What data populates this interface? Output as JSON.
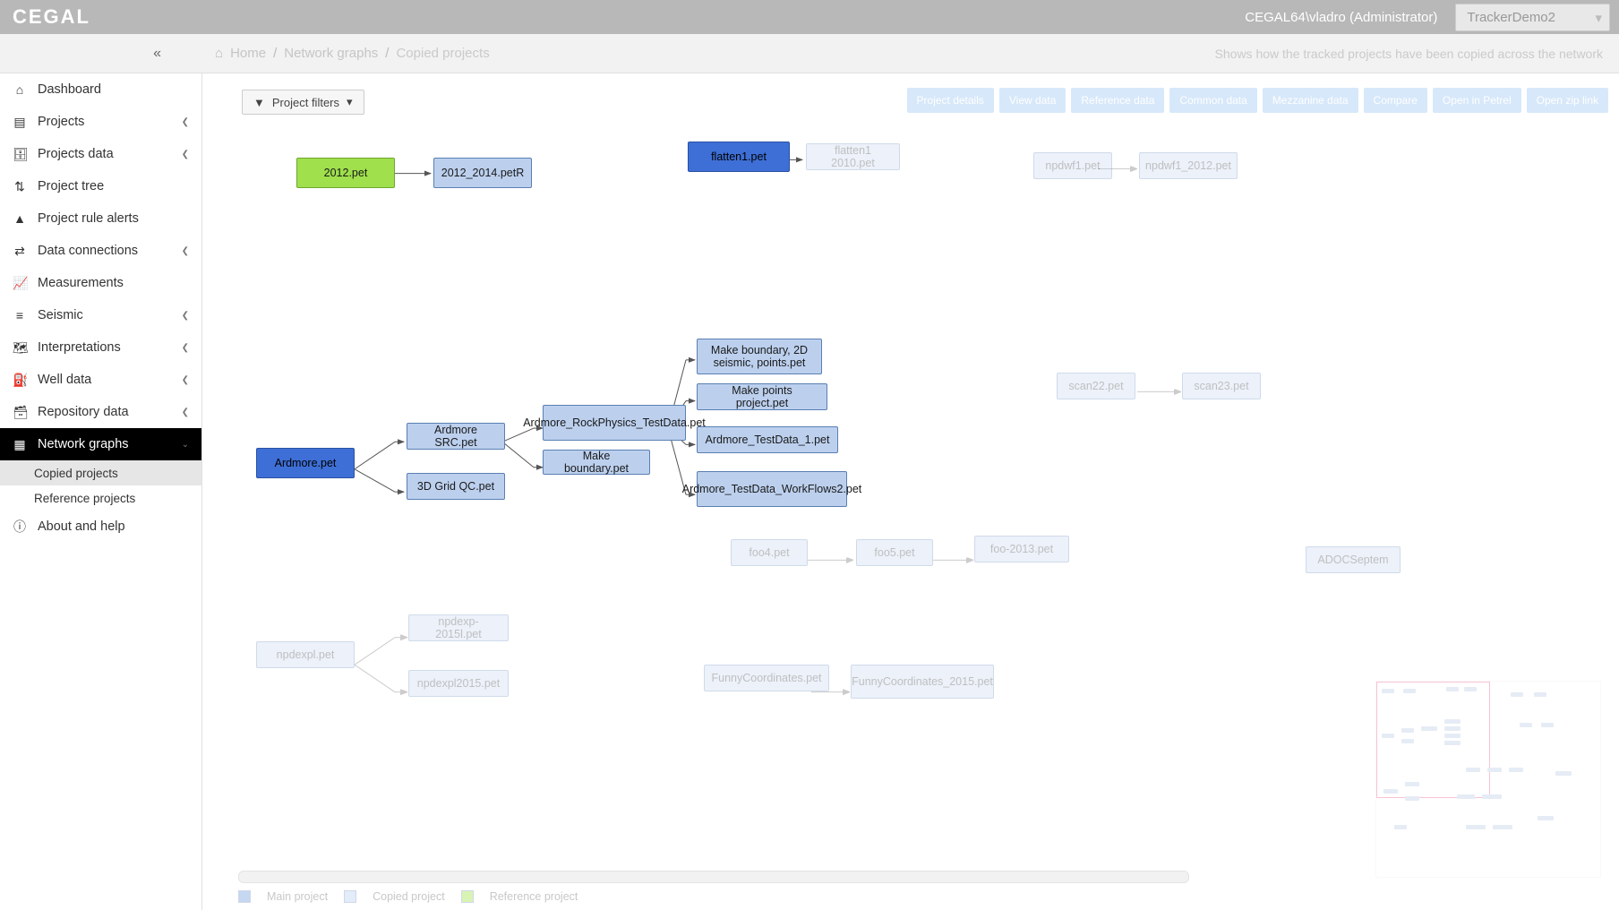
{
  "brand": "CEGAL",
  "user_label": "CEGAL64\\vladro (Administrator)",
  "workspace": "TrackerDemo2",
  "breadcrumb": {
    "home": "Home",
    "section": "Network graphs",
    "current": "Copied projects"
  },
  "hint": "Shows how the tracked projects have been copied across the network",
  "sidebar": {
    "items": [
      {
        "label": "Dashboard",
        "icon": "⌂"
      },
      {
        "label": "Projects",
        "icon": "▤",
        "expandable": true
      },
      {
        "label": "Projects data",
        "icon": "🗄",
        "expandable": true
      },
      {
        "label": "Project tree",
        "icon": "⇅"
      },
      {
        "label": "Project rule alerts",
        "icon": "▲"
      },
      {
        "label": "Data connections",
        "icon": "⇄",
        "expandable": true
      },
      {
        "label": "Measurements",
        "icon": "📈"
      },
      {
        "label": "Seismic",
        "icon": "≡",
        "expandable": true
      },
      {
        "label": "Interpretations",
        "icon": "🗺",
        "expandable": true
      },
      {
        "label": "Well data",
        "icon": "⛽",
        "expandable": true
      },
      {
        "label": "Repository data",
        "icon": "🗃",
        "expandable": true
      },
      {
        "label": "Network graphs",
        "icon": "▦",
        "expandable": true,
        "active": true
      },
      {
        "label": "About and help",
        "icon": "ⓘ"
      }
    ],
    "subitems": [
      {
        "label": "Copied projects",
        "current": true
      },
      {
        "label": "Reference projects"
      }
    ]
  },
  "toolbar": {
    "filter_label": "Project filters",
    "buttons": [
      "Project details",
      "View data",
      "Reference data",
      "Common data",
      "Mezzanine data",
      "Compare",
      "Open in Petrel",
      "Open zip link"
    ]
  },
  "legend": {
    "main": "Main project",
    "copied": "Copied project",
    "ref": "Reference project"
  },
  "nodes": {
    "n2012": "2012.pet",
    "n2012_2014": "2012_2014.petR",
    "flatten1": "flatten1.pet",
    "flatten1_2010": "flatten1 2010.pet",
    "npdwf1": "npdwf1.pet",
    "npdwf1_2012": "npdwf1_2012.pet",
    "ardmore": "Ardmore.pet",
    "ardmore_src": "Ardmore SRC.pet",
    "grid3d": "3D Grid QC.pet",
    "rockphys": "Ardmore_RockPhysics_TestData.pet",
    "makebound": "Make boundary.pet",
    "makebound2d": "Make boundary, 2D seismic,  points.pet",
    "makepoints": "Make points project.pet",
    "testdata1": "Ardmore_TestData_1.pet",
    "testdata_wf2": "Ardmore_TestData_WorkFlows2.pet",
    "scan22": "scan22.pet",
    "scan23": "scan23.pet",
    "foo4": "foo4.pet",
    "foo5": "foo5.pet",
    "foo2013": "foo-2013.pet",
    "adoc": "ADOCSeptem",
    "npdexpl": "npdexpl.pet",
    "npdexp2015l": "npdexp-2015l.pet",
    "npdexpl2015": "npdexpl2015.pet",
    "funnycoord": "FunnyCoordinates.pet",
    "funnycoord2015": "FunnyCoordinates_2015.pet"
  }
}
